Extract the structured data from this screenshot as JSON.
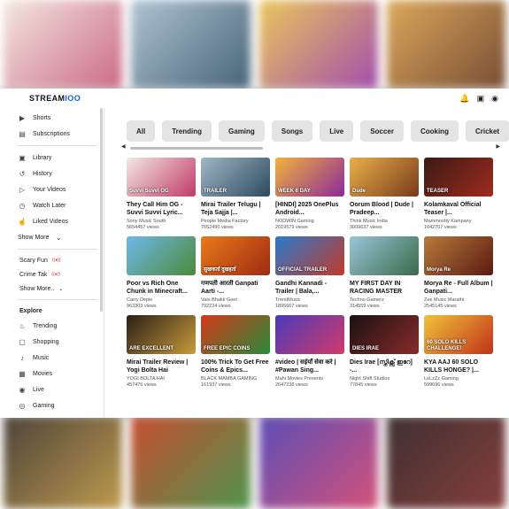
{
  "app": {
    "logo_main": "STREAM",
    "logo_accent": "IOO"
  },
  "colors": {
    "accent": "#1a5be0",
    "live_dot": "#dd3333",
    "chip_bg": "#e4e4e4"
  },
  "top_icons": [
    "bell-icon",
    "video-camera-icon",
    "account-icon"
  ],
  "sidebar": {
    "items_top": [
      {
        "label": "Shorts",
        "icon": "shorts-icon"
      },
      {
        "label": "Subscriptions",
        "icon": "subscriptions-icon"
      }
    ],
    "items_you": [
      {
        "label": "Library",
        "icon": "library-icon"
      },
      {
        "label": "History",
        "icon": "history-icon"
      },
      {
        "label": "Your Videos",
        "icon": "your-videos-icon"
      },
      {
        "label": "Watch Later",
        "icon": "clock-icon"
      },
      {
        "label": "Liked Videos",
        "icon": "thumbs-up-icon"
      },
      {
        "label": "Show More",
        "icon": "chevron-down-icon"
      }
    ],
    "subscriptions": [
      {
        "label": "Scary Fun"
      },
      {
        "label": "Crime Tak"
      }
    ],
    "subs_show_more": "Show More..",
    "explore_title": "Explore",
    "explore": [
      {
        "label": "Trending",
        "icon": "fire-icon"
      },
      {
        "label": "Shopping",
        "icon": "bag-icon"
      },
      {
        "label": "Music",
        "icon": "music-icon"
      },
      {
        "label": "Movies",
        "icon": "film-icon"
      },
      {
        "label": "Live",
        "icon": "live-icon"
      },
      {
        "label": "Gaming",
        "icon": "gamepad-icon"
      }
    ]
  },
  "chips": [
    "All",
    "Trending",
    "Gaming",
    "Songs",
    "Live",
    "Soccer",
    "Cooking",
    "Cricket"
  ],
  "videos": [
    {
      "title": "They Call Him OG - Suvvi Suvvi Lyric...",
      "channel": "Sony Music South",
      "views": "5654457 views",
      "thumb_text": "Suvvi Suvvi OG",
      "c1": "#f2e8e0",
      "c2": "#c23a6a"
    },
    {
      "title": "Mirai Trailer Telugu | Teja Sajja |...",
      "channel": "People Media Factory",
      "views": "7652490 views",
      "thumb_text": "TRAILER",
      "c1": "#9fb7c7",
      "c2": "#2e4a5e"
    },
    {
      "title": "[HINDI] 2025 OnePlus Android...",
      "channel": "NODWIN Gaming",
      "views": "2019579 views",
      "thumb_text": "WEEK 6 DAY",
      "c1": "#f0b23a",
      "c2": "#8e2a9c"
    },
    {
      "title": "Oorum Blood | Dude | Pradeep...",
      "channel": "Think Music India",
      "views": "3009637 views",
      "thumb_text": "Dude",
      "c1": "#e8b04a",
      "c2": "#7a3a1a"
    },
    {
      "title": "Kolamkaval Official Teaser |...",
      "channel": "Mammootty Kampany",
      "views": "1042707 views",
      "thumb_text": "TEASER",
      "c1": "#3a1a14",
      "c2": "#a02a1e"
    },
    {
      "title": "Poor vs Rich One Chunk in Minecraft...",
      "channel": "Carry Depie",
      "views": "963303 views",
      "thumb_text": "",
      "c1": "#6fb8e8",
      "c2": "#4c8a3a"
    },
    {
      "title": "गणपती आरती Ganpati Aarti -...",
      "channel": "Vats Bhakti Geet",
      "views": "792224 views",
      "thumb_text": "सुखकर्ता दुखहर्ता",
      "c1": "#e87a1a",
      "c2": "#a02a12"
    },
    {
      "title": "Gandhi Kannadi - Trailer | Bala,...",
      "channel": "TrendMusic",
      "views": "1895667 views",
      "thumb_text": "OFFICIAL TRAILER",
      "c1": "#2a7acc",
      "c2": "#c23a2a"
    },
    {
      "title": "MY FIRST DAY IN RACING MASTER",
      "channel": "Techno Gamerz",
      "views": "314559 views",
      "thumb_text": "",
      "c1": "#9ac4d8",
      "c2": "#3a6a4a"
    },
    {
      "title": "Morya Re - Full Album | Ganpati...",
      "channel": "Zee Music Marathi",
      "views": "2545145 views",
      "thumb_text": "Morya Re",
      "c1": "#b87a3a",
      "c2": "#5a1a12"
    },
    {
      "title": "Mirai Trailer Review | Yogi Bolta Hai",
      "channel": "YOGI BOLTA HAI",
      "views": "457476 views",
      "thumb_text": "ARE EXCELLENT",
      "c1": "#2a2018",
      "c2": "#c89a3a"
    },
    {
      "title": "100% Trick To Get Free Coins & Epics...",
      "channel": "BLACK MAMBA GAMING",
      "views": "161937 views",
      "thumb_text": "FREE EPIC COINS",
      "c1": "#d23a1a",
      "c2": "#2a8a3a"
    },
    {
      "title": "#video | सईयाँ सेवा करे | #Pawan Sing...",
      "channel": "Mahi Movies Presents",
      "views": "2647238 views",
      "thumb_text": "",
      "c1": "#4a3ab8",
      "c2": "#d23a6a"
    },
    {
      "title": "Dies Irae [സ്നിക്സ് ഇറേ] -...",
      "channel": "Night Shift Studios",
      "views": "77845 views",
      "thumb_text": "DIES IRAE",
      "c1": "#1a1212",
      "c2": "#8a2a2a"
    },
    {
      "title": "KYA AAJ 60 SOLO KILLS HONGE? |...",
      "channel": "LoLzZz Gaming",
      "views": "599696 views",
      "thumb_text": "60 SOLO KILLS CHALLENGE!",
      "c1": "#f0c23a",
      "c2": "#c2321a"
    }
  ],
  "bg_top": [
    {
      "c1": "#f3e6dc",
      "c2": "#c65a7a"
    },
    {
      "c1": "#a7bfcf",
      "c2": "#34526a"
    },
    {
      "c1": "#e8c24a",
      "c2": "#9a3aa4"
    },
    {
      "c1": "#d8a04a",
      "c2": "#6a3a20"
    }
  ],
  "bg_bottom": [
    {
      "c1": "#3a3026",
      "c2": "#b8903a"
    },
    {
      "c1": "#c23a1a",
      "c2": "#3a8a3a"
    },
    {
      "c1": "#4a3ab0",
      "c2": "#d0406a"
    },
    {
      "c1": "#2a1a1a",
      "c2": "#7a2a2a"
    }
  ]
}
